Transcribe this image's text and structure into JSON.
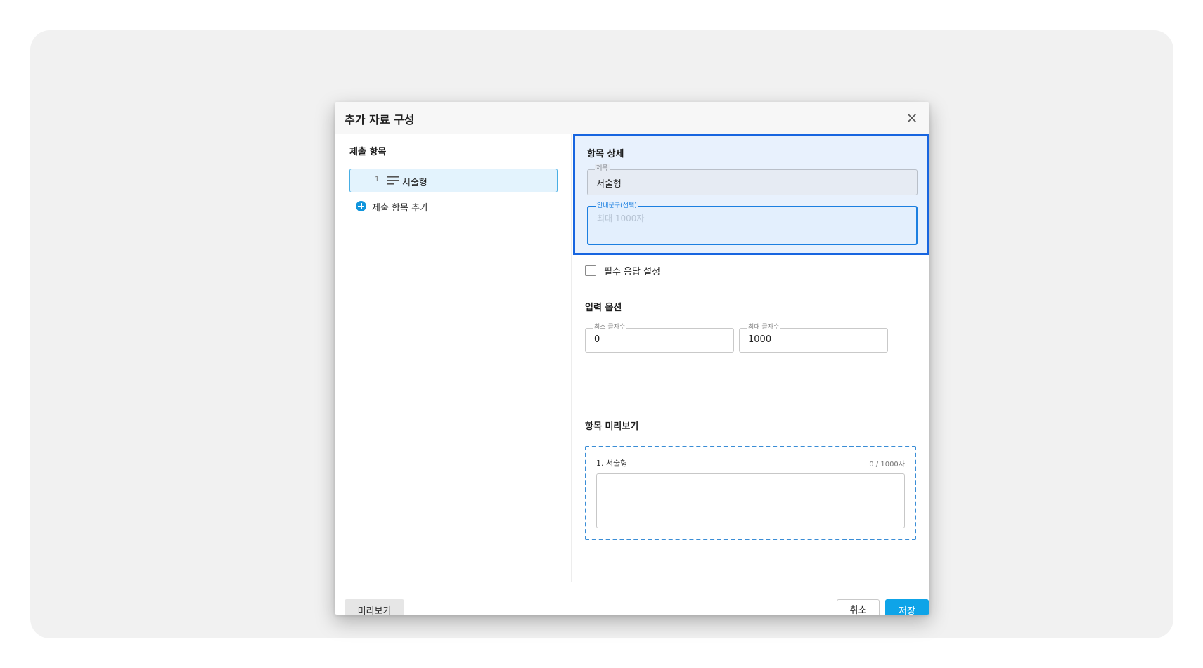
{
  "dialog": {
    "title": "추가 자료 구성",
    "close_icon": "close-icon"
  },
  "left_panel": {
    "section_title": "제출 항목",
    "items": [
      {
        "number": "1",
        "icon": "text-lines-icon",
        "label": "서술형"
      }
    ],
    "add_item_label": "제출 항목 추가",
    "add_icon": "plus-circle-icon"
  },
  "detail": {
    "section_title": "항목 상세",
    "title_field": {
      "legend": "제목",
      "value": "서술형"
    },
    "guide_field": {
      "legend": "안내문구(선택)",
      "placeholder": "최대 1000자",
      "value": ""
    },
    "required_checkbox": {
      "label": "필수 응답 설정",
      "checked": false
    }
  },
  "input_options": {
    "section_title": "입력 옵션",
    "min_chars": {
      "legend": "최소 글자수",
      "value": "0"
    },
    "max_chars": {
      "legend": "최대 글자수",
      "value": "1000"
    }
  },
  "preview": {
    "section_title": "항목 미리보기",
    "question_label": "1.  서술형",
    "char_count": "0 / 1000자"
  },
  "footer": {
    "preview_button": "미리보기",
    "cancel_button": "취소",
    "save_button": "저장"
  },
  "colors": {
    "accent": "#0ea4e8",
    "highlight_border": "#1765e0",
    "highlight_bg": "#e8f1fd",
    "selected_item_bg": "#e3f3fd",
    "selected_item_border": "#48aee4"
  }
}
